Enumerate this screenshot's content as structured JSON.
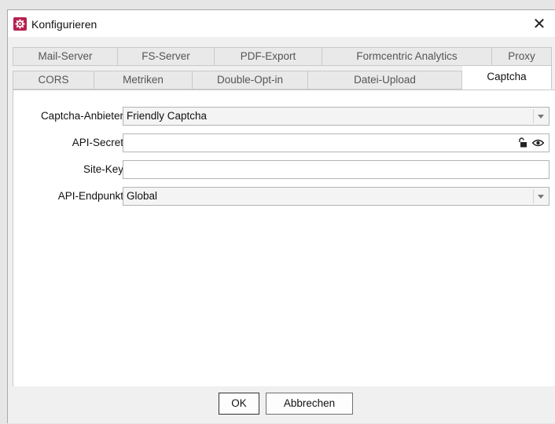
{
  "window": {
    "title": "Konfigurieren",
    "close_glyph": "✕",
    "icon": "gear-icon",
    "accent": "#b5204e"
  },
  "tabs_row1": [
    {
      "label": "Mail-Server"
    },
    {
      "label": "FS-Server"
    },
    {
      "label": "PDF-Export"
    },
    {
      "label": "Formcentric Analytics"
    },
    {
      "label": "Proxy"
    }
  ],
  "tabs_row2": [
    {
      "label": "CORS"
    },
    {
      "label": "Metriken"
    },
    {
      "label": "Double-Opt-in"
    },
    {
      "label": "Datei-Upload"
    },
    {
      "label": "Captcha",
      "active": true
    }
  ],
  "form": {
    "provider": {
      "label": "Captcha-Anbieter",
      "value": "Friendly Captcha"
    },
    "secret": {
      "label": "API-Secret",
      "value": ""
    },
    "sitekey": {
      "label": "Site-Key",
      "value": ""
    },
    "endpoint": {
      "label": "API-Endpunkt",
      "value": "Global"
    }
  },
  "buttons": {
    "ok": "OK",
    "cancel": "Abbrechen"
  }
}
